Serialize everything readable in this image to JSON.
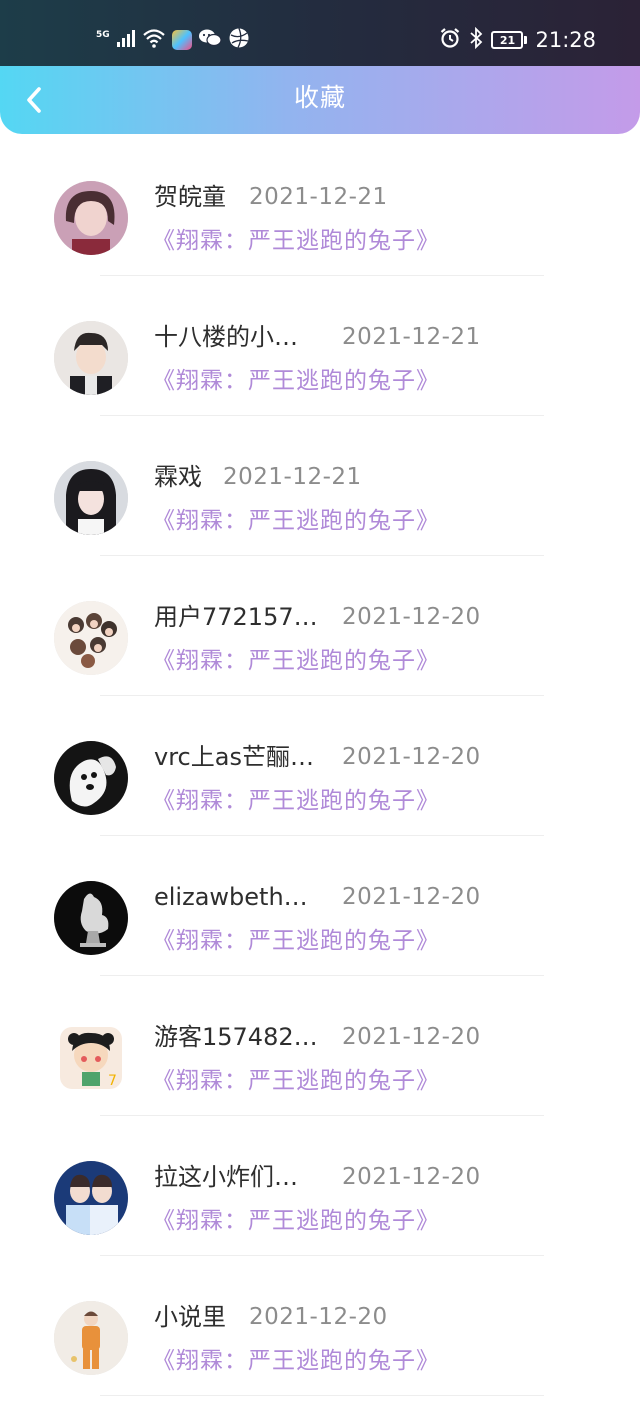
{
  "status_bar": {
    "network": "5G",
    "time": "21:28",
    "battery": "21",
    "icons": [
      "signal-icon",
      "wifi-icon",
      "app-icon",
      "wechat-icon",
      "basketball-icon",
      "alarm-icon",
      "bluetooth-icon",
      "battery-icon"
    ]
  },
  "header": {
    "title": "收藏",
    "back_icon": "chevron-left-icon"
  },
  "colors": {
    "header_gradient_start": "#54d7f3",
    "header_gradient_end": "#c49be9",
    "book_title": "#b08ad8",
    "username": "#2e2e2e",
    "date": "#8c8c8c"
  },
  "favorites": [
    {
      "username": "贺皖童",
      "date": "2021-12-21",
      "book": "《翔霖：严王逃跑的兔子》"
    },
    {
      "username": "十八楼的小…",
      "date": "2021-12-21",
      "book": "《翔霖：严王逃跑的兔子》"
    },
    {
      "username": "霖戏",
      "date": "2021-12-21",
      "book": "《翔霖：严王逃跑的兔子》"
    },
    {
      "username": "用户772157…",
      "date": "2021-12-20",
      "book": "《翔霖：严王逃跑的兔子》"
    },
    {
      "username": "vrc上as芒酾…",
      "date": "2021-12-20",
      "book": "《翔霖：严王逃跑的兔子》"
    },
    {
      "username": "elizawbeth…",
      "date": "2021-12-20",
      "book": "《翔霖：严王逃跑的兔子》"
    },
    {
      "username": "游客157482…",
      "date": "2021-12-20",
      "book": "《翔霖：严王逃跑的兔子》"
    },
    {
      "username": "拉这小炸们…",
      "date": "2021-12-20",
      "book": "《翔霖：严王逃跑的兔子》"
    },
    {
      "username": "小说里",
      "date": "2021-12-20",
      "book": "《翔霖：严王逃跑的兔子》"
    }
  ]
}
